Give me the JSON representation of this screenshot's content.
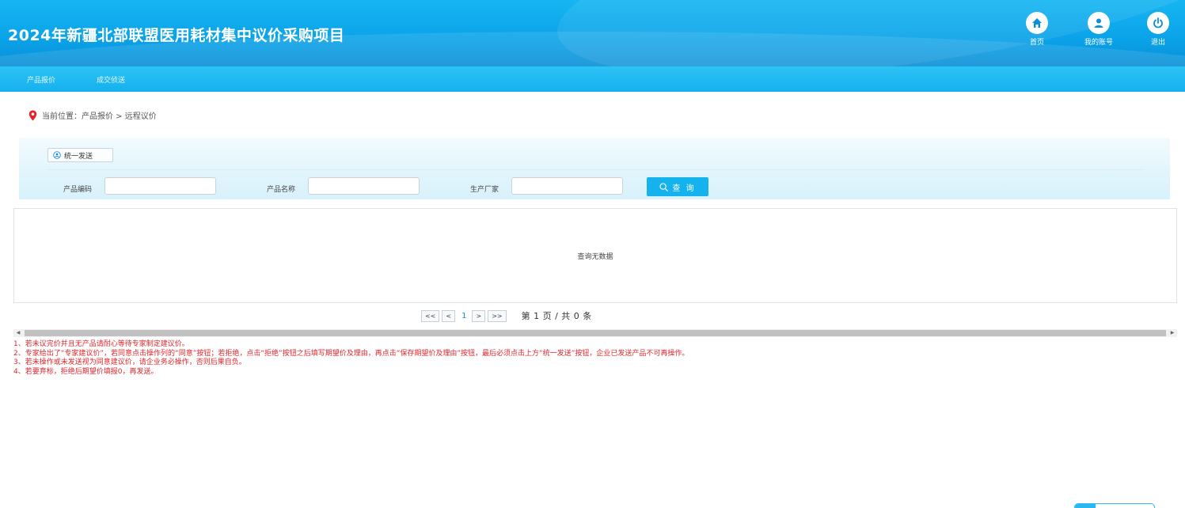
{
  "header": {
    "title": "2024年新疆北部联盟医用耗材集中议价采购项目",
    "buttons": [
      {
        "label": "首页",
        "icon": "home-icon"
      },
      {
        "label": "我的账号",
        "icon": "user-icon"
      },
      {
        "label": "退出",
        "icon": "power-icon"
      }
    ]
  },
  "nav": {
    "items": [
      {
        "label": "产品报价"
      },
      {
        "label": "成交侦送"
      }
    ]
  },
  "breadcrumb": {
    "text": "当前位置：产品报价 > 远程议价",
    "icon": "location-pin-icon"
  },
  "filters": {
    "send_button": "统一发送",
    "fields": [
      {
        "label": "产品编码",
        "value": ""
      },
      {
        "label": "产品名称",
        "value": ""
      },
      {
        "label": "生产厂家",
        "value": ""
      }
    ],
    "query_button": "查 询"
  },
  "grid": {
    "empty_text": "查询无数据"
  },
  "pager": {
    "first": "<<",
    "prev": "<",
    "current": "1",
    "next": ">",
    "last": ">>",
    "info": "第 1 页 / 共 0 条"
  },
  "notes": [
    "1、若未议完价并且无产品请耐心等待专家制定建议价。",
    "2、专家给出了“专家建议价”，若同意点击操作列的“同意”按钮；若拒绝，点击“拒绝”按钮之后填写期望价及理由，再点击“保存期望价及理由”按钮，最后必须点击上方“统一发送”按钮，企业已发送产品不可再操作。",
    "3、若未操作或未发送视为同意建议价，请企业务必操作，否则后果自负。",
    "4、若要弃标，拒绝后期望价填报0，再发送。"
  ],
  "colors": {
    "header_blue": "#0aa2e8",
    "nav_blue": "#16b0ef",
    "query_button": "#15b3ee",
    "note_red": "#e4262b",
    "pin_red": "#e4262b"
  }
}
